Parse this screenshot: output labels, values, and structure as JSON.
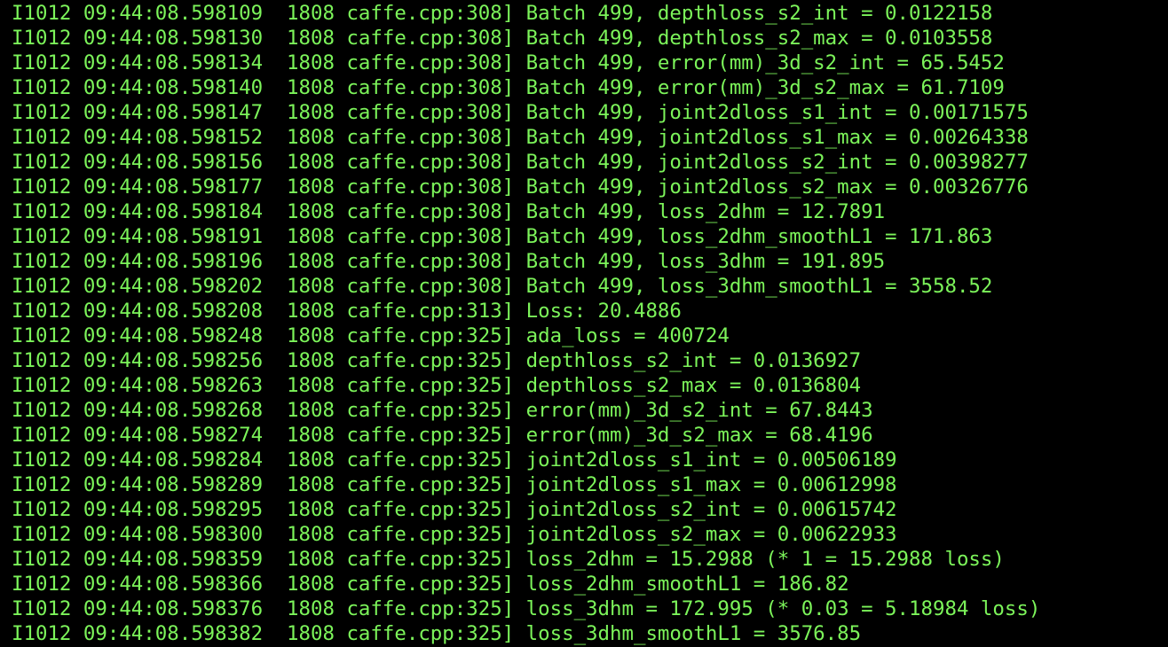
{
  "terminal": {
    "text_color": "#7CF45A",
    "background_color": "#000000",
    "lines": [
      "I1012 09:44:08.598109  1808 caffe.cpp:308] Batch 499, depthloss_s2_int = 0.0122158",
      "I1012 09:44:08.598130  1808 caffe.cpp:308] Batch 499, depthloss_s2_max = 0.0103558",
      "I1012 09:44:08.598134  1808 caffe.cpp:308] Batch 499, error(mm)_3d_s2_int = 65.5452",
      "I1012 09:44:08.598140  1808 caffe.cpp:308] Batch 499, error(mm)_3d_s2_max = 61.7109",
      "I1012 09:44:08.598147  1808 caffe.cpp:308] Batch 499, joint2dloss_s1_int = 0.00171575",
      "I1012 09:44:08.598152  1808 caffe.cpp:308] Batch 499, joint2dloss_s1_max = 0.00264338",
      "I1012 09:44:08.598156  1808 caffe.cpp:308] Batch 499, joint2dloss_s2_int = 0.00398277",
      "I1012 09:44:08.598177  1808 caffe.cpp:308] Batch 499, joint2dloss_s2_max = 0.00326776",
      "I1012 09:44:08.598184  1808 caffe.cpp:308] Batch 499, loss_2dhm = 12.7891",
      "I1012 09:44:08.598191  1808 caffe.cpp:308] Batch 499, loss_2dhm_smoothL1 = 171.863",
      "I1012 09:44:08.598196  1808 caffe.cpp:308] Batch 499, loss_3dhm = 191.895",
      "I1012 09:44:08.598202  1808 caffe.cpp:308] Batch 499, loss_3dhm_smoothL1 = 3558.52",
      "I1012 09:44:08.598208  1808 caffe.cpp:313] Loss: 20.4886",
      "I1012 09:44:08.598248  1808 caffe.cpp:325] ada_loss = 400724",
      "I1012 09:44:08.598256  1808 caffe.cpp:325] depthloss_s2_int = 0.0136927",
      "I1012 09:44:08.598263  1808 caffe.cpp:325] depthloss_s2_max = 0.0136804",
      "I1012 09:44:08.598268  1808 caffe.cpp:325] error(mm)_3d_s2_int = 67.8443",
      "I1012 09:44:08.598274  1808 caffe.cpp:325] error(mm)_3d_s2_max = 68.4196",
      "I1012 09:44:08.598284  1808 caffe.cpp:325] joint2dloss_s1_int = 0.00506189",
      "I1012 09:44:08.598289  1808 caffe.cpp:325] joint2dloss_s1_max = 0.00612998",
      "I1012 09:44:08.598295  1808 caffe.cpp:325] joint2dloss_s2_int = 0.00615742",
      "I1012 09:44:08.598300  1808 caffe.cpp:325] joint2dloss_s2_max = 0.00622933",
      "I1012 09:44:08.598359  1808 caffe.cpp:325] loss_2dhm = 15.2988 (* 1 = 15.2988 loss)",
      "I1012 09:44:08.598366  1808 caffe.cpp:325] loss_2dhm_smoothL1 = 186.82",
      "I1012 09:44:08.598376  1808 caffe.cpp:325] loss_3dhm = 172.995 (* 0.03 = 5.18984 loss)",
      "I1012 09:44:08.598382  1808 caffe.cpp:325] loss_3dhm_smoothL1 = 3576.85"
    ]
  }
}
